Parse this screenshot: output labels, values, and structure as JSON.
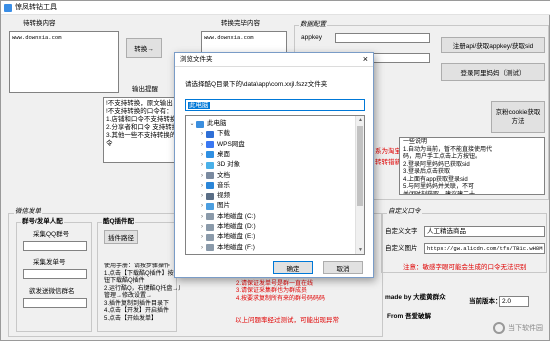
{
  "window": {
    "title": "惊凤转钻工具"
  },
  "left": {
    "input_label": "待转换内容",
    "input_text": "www.downxia.com",
    "convert_button": "转换→",
    "output_label": "转换完毕内容",
    "output_text": "www.downxia.com",
    "tips_label": "输出提醒",
    "tips_lines": [
      "!不支持转换，原文输出",
      "!不支持转换的口令有：",
      "1.店铺和口令不支持转换",
      "2.分享者和口令 支持转换",
      "3.其他一些不支持转换的口",
      "令"
    ]
  },
  "config": {
    "group_label": "数据配置",
    "appkey_label": "appkey",
    "sid_label": "sid",
    "register_button": "注册api/获取appkey/获取sid",
    "login_button": "登录阿里妈妈（测试）",
    "cookie_button": "京粉cookie获取方法",
    "red_note1": "系为淘宝",
    "red_note2": "转转错新",
    "tips_lines": [
      "一些说明",
      "1.自动为当前，暂不能直接使用代",
      "码，用户手工点击上方按钮。",
      "2.登录阿里妈妈已获取sid",
      "3.登录后点击获取",
      "4.上面有app获取登录sid",
      "5.与阿里妈妈并关联，不可",
      "关闭时刻获取，建议建二十",
      "日，获取该令不再存在"
    ]
  },
  "publish": {
    "group_label": "微信发单",
    "qq_group_label": "群号/发单人配",
    "collect_qq_label": "采集QQ群号",
    "sender_label": "采集发单号",
    "wechat_label": "欲发送微信群名",
    "plugin_group_label": "酷Q插件配",
    "plugin_button": "插件路径",
    "usage_lines": [
      "使用手册：请按步骤操作",
      "1.点击【下载酷Q插件】按",
      "钮下载酷Q插件",
      "2.运行酷Q，右键酷Q托盘→应用→",
      "管理→修改设置→",
      "3.插件复制到插件目录下",
      "4.点击【开发】开启插件",
      "5.点击【开始发单】"
    ],
    "red_lines": [
      "1.使用时请务必打开转换",
      "2.请保证发单号是群一直在线",
      "3.请保证采集群也为群成员",
      "4.按要求复制所有来的群号码码码"
    ],
    "red_footer": "以上问题率经过测试，可能出现异常"
  },
  "custom": {
    "group_label": "自定义口令",
    "text_label": "自定义文字",
    "text_value": "人工精选商品",
    "image_label": "自定义图片",
    "image_value": "https://gw.alicdn.com/tfs/TB1c.wH8M",
    "red_note": "注意：敏感字眼可能会生成的口令无法识别"
  },
  "footer": {
    "made_by": "made by 大榄黄群众",
    "from": "From 吾爱破解",
    "version_label": "当前版本：",
    "version_value": "2.0",
    "watermark": "当下软件园"
  },
  "dialog": {
    "title": "浏览文件夹",
    "close": "×",
    "instruction": "请选择酷Q目录下的\\data\\app\\com.xxjl.fszz文件夹",
    "selected": "此电脑",
    "tree": [
      {
        "label": "此电脑",
        "indent": 0,
        "arrow": "v",
        "icon": "pc-icon",
        "color": "#3b8ede"
      },
      {
        "label": "下载",
        "indent": 1,
        "arrow": ">",
        "icon": "download-icon",
        "color": "#2f6fd6"
      },
      {
        "label": "WPS网盘",
        "indent": 1,
        "arrow": ">",
        "icon": "cloud-icon",
        "color": "#3a78f2"
      },
      {
        "label": "桌面",
        "indent": 1,
        "arrow": ">",
        "icon": "desktop-icon",
        "color": "#2f8fe2"
      },
      {
        "label": "3D 对象",
        "indent": 1,
        "arrow": ">",
        "icon": "cube-icon",
        "color": "#4ab0e8"
      },
      {
        "label": "文档",
        "indent": 1,
        "arrow": ">",
        "icon": "document-icon",
        "color": "#7a8aa0"
      },
      {
        "label": "音乐",
        "indent": 1,
        "arrow": ">",
        "icon": "music-icon",
        "color": "#2b86d8"
      },
      {
        "label": "视频",
        "indent": 1,
        "arrow": ">",
        "icon": "video-icon",
        "color": "#5a6e86"
      },
      {
        "label": "图片",
        "indent": 1,
        "arrow": ">",
        "icon": "picture-icon",
        "color": "#4b9ee0"
      },
      {
        "label": "本地磁盘 (C:)",
        "indent": 1,
        "arrow": ">",
        "icon": "drive-icon",
        "color": "#8a9aaa"
      },
      {
        "label": "本地磁盘 (D:)",
        "indent": 1,
        "arrow": ">",
        "icon": "drive-icon",
        "color": "#8a9aaa"
      },
      {
        "label": "本地磁盘 (E:)",
        "indent": 1,
        "arrow": ">",
        "icon": "drive-icon",
        "color": "#8a9aaa"
      },
      {
        "label": "本地磁盘 (F:)",
        "indent": 1,
        "arrow": ">",
        "icon": "drive-icon",
        "color": "#8a9aaa"
      }
    ],
    "ok_button": "确定",
    "cancel_button": "取消"
  }
}
